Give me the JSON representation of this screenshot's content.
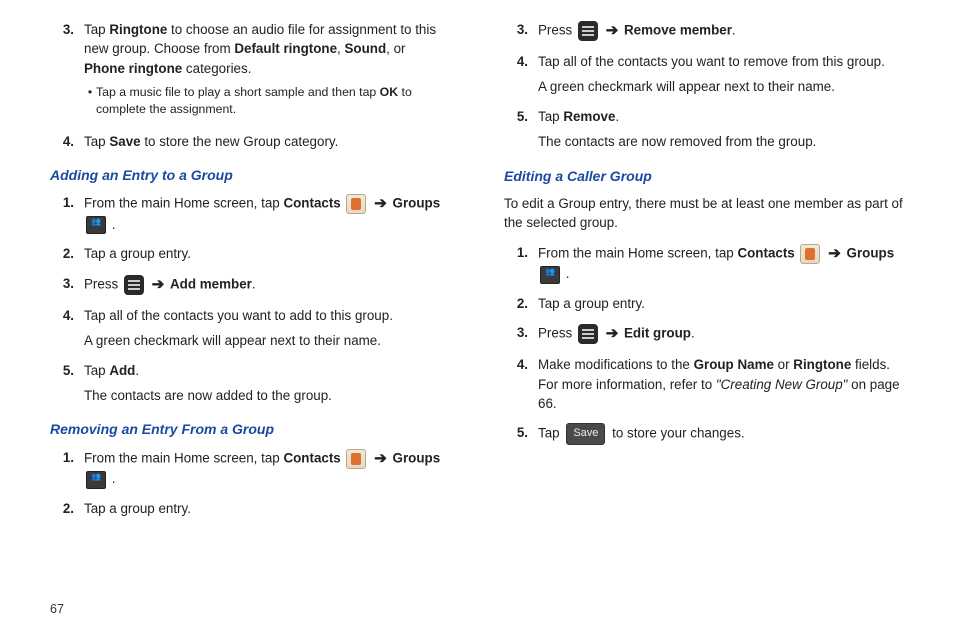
{
  "pageNumber": "67",
  "col1": {
    "step3": {
      "num": "3.",
      "t1a": "Tap ",
      "t1b": "Ringtone",
      "t1c": " to choose an audio file for assignment to this new group. Choose from ",
      "t1d": "Default ringtone",
      "t1e": ", ",
      "t1f": "Sound",
      "t1g": ", or ",
      "t1h": "Phone ringtone",
      "t1i": " categories.",
      "bullet_a": "Tap a music file to play a short sample and then tap ",
      "bullet_b": "OK",
      "bullet_c": " to complete the assignment."
    },
    "step4": {
      "num": "4.",
      "a": "Tap ",
      "b": "Save",
      "c": " to store the new Group category."
    },
    "headingA": "Adding an Entry to a Group",
    "a1": {
      "num": "1.",
      "a": "From the main Home screen, tap ",
      "b": "Contacts",
      "c": " ",
      "arrow": "➔",
      "d": " ",
      "e": "Groups",
      "f": " ."
    },
    "a2": {
      "num": "2.",
      "a": "Tap a group entry."
    },
    "a3": {
      "num": "3.",
      "a": "Press ",
      "arrow": "➔",
      "b": " ",
      "c": "Add member",
      "d": "."
    },
    "a4": {
      "num": "4.",
      "a": "Tap all of the contacts you want to add to this group.",
      "b": "A green checkmark will appear next to their name."
    },
    "a5": {
      "num": "5.",
      "a": "Tap ",
      "b": "Add",
      "c": ".",
      "d": "The contacts are now added to the group."
    },
    "headingB": "Removing an Entry From a Group",
    "b1": {
      "num": "1.",
      "a": "From the main Home screen, tap ",
      "b": "Contacts",
      "arrow": "➔",
      "c": "Groups",
      "d": " ."
    },
    "b2": {
      "num": "2.",
      "a": "Tap a group entry."
    }
  },
  "col2": {
    "c3": {
      "num": "3.",
      "a": "Press ",
      "arrow": "➔",
      "b": " ",
      "c": "Remove member",
      "d": "."
    },
    "c4": {
      "num": "4.",
      "a": "Tap all of the contacts you want to remove from this group.",
      "b": "A green checkmark will appear next to their name."
    },
    "c5": {
      "num": "5.",
      "a": "Tap ",
      "b": "Remove",
      "c": ".",
      "d": "The contacts are now removed from the group."
    },
    "headingC": "Editing a Caller Group",
    "intro": "To edit a Group entry, there must be at least one member as part of the selected group.",
    "d1": {
      "num": "1.",
      "a": "From the main Home screen, tap ",
      "b": "Contacts",
      "arrow": "➔",
      "c": "Groups",
      "d": " ."
    },
    "d2": {
      "num": "2.",
      "a": "Tap a group entry."
    },
    "d3": {
      "num": "3.",
      "a": "Press ",
      "arrow": "➔",
      "b": " ",
      "c": "Edit group",
      "d": "."
    },
    "d4": {
      "num": "4.",
      "a": "Make modifications to the ",
      "b": "Group Name",
      "c": " or ",
      "d": "Ringtone",
      "e": " fields. For more information, refer to ",
      "ref": "\"Creating New Group\"",
      "f": " on page 66."
    },
    "d5": {
      "num": "5.",
      "a": "Tap ",
      "save": "Save",
      "b": " to store your changes."
    }
  }
}
